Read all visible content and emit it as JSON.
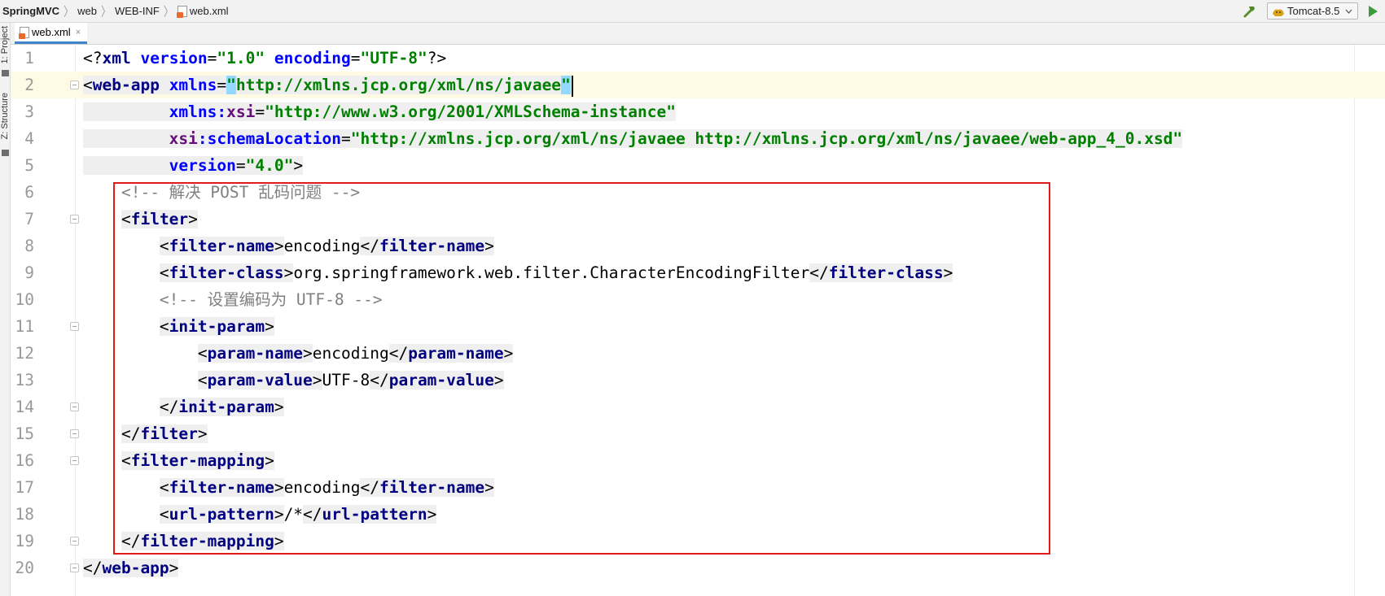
{
  "breadcrumb": {
    "project": "SpringMVC",
    "folder1": "web",
    "folder2": "WEB-INF",
    "file": "web.xml"
  },
  "toolbar": {
    "run_config": "Tomcat-8.5"
  },
  "tool_windows": {
    "project": "1: Project",
    "structure": "Z: Structure"
  },
  "tab": {
    "label": "web.xml",
    "close": "×"
  },
  "editor": {
    "line_numbers": [
      "1",
      "2",
      "3",
      "4",
      "5",
      "6",
      "7",
      "8",
      "9",
      "10",
      "11",
      "12",
      "13",
      "14",
      "15",
      "16",
      "17",
      "18",
      "19",
      "20"
    ],
    "decl": {
      "open": "<?",
      "name": "xml",
      "version_attr": "version",
      "version_val": "\"1.0\"",
      "encoding_attr": "encoding",
      "encoding_val": "\"UTF-8\"",
      "close": "?>"
    },
    "webapp": {
      "tag": "web-app",
      "xmlns_attr": "xmlns",
      "xmlns_val": "http://xmlns.jcp.org/xml/ns/javaee",
      "xsi_prefix": "xmlns",
      "xsi_local": "xsi",
      "xsi_val": "\"http://www.w3.org/2001/XMLSchema-instance\"",
      "schema_prefix": "xsi",
      "schema_local": "schemaLocation",
      "schema_val": "\"http://xmlns.jcp.org/xml/ns/javaee http://xmlns.jcp.org/xml/ns/javaee/web-app_4_0.xsd\"",
      "version_attr": "version",
      "version_val": "\"4.0\""
    },
    "comment1": "<!-- 解决 POST 乱码问题 -->",
    "comment2": "<!-- 设置编码为 UTF-8 -->",
    "tags": {
      "filter": "filter",
      "filter_name": "filter-name",
      "filter_class": "filter-class",
      "init_param": "init-param",
      "param_name": "param-name",
      "param_value": "param-value",
      "filter_mapping": "filter-mapping",
      "url_pattern": "url-pattern"
    },
    "values": {
      "encoding": "encoding",
      "class": "org.springframework.web.filter.CharacterEncodingFilter",
      "utf8": "UTF-8",
      "pattern": "/*"
    }
  },
  "colors": {
    "tag": "#000080",
    "attribute": "#0000ff",
    "namespace": "#660e7a",
    "string": "#008000",
    "comment": "#808080",
    "annotation_box": "#e11a1a",
    "caret_line": "#fffae3"
  },
  "icons": {
    "file": "xml-file-icon",
    "build": "hammer-icon",
    "server": "tomcat-icon",
    "run": "play-icon"
  }
}
